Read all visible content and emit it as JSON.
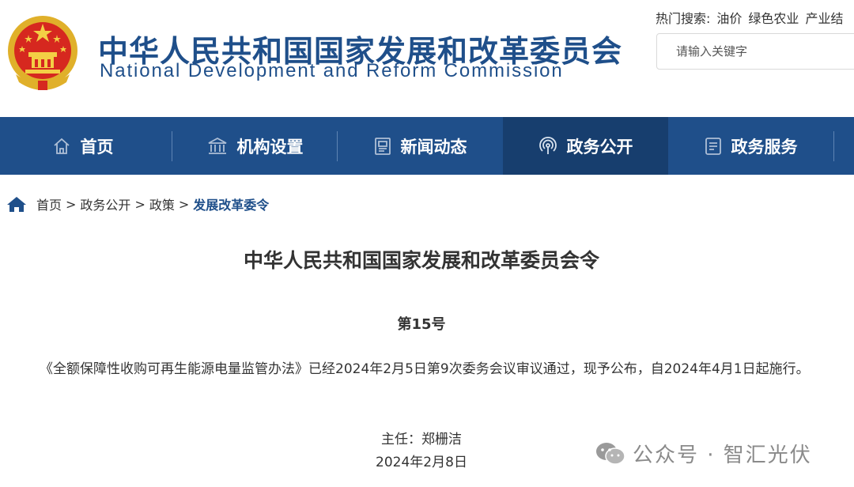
{
  "header": {
    "emblem_icon": "national-emblem",
    "title_cn": "中华人民共和国国家发展和改革委员会",
    "title_en": "National Development and Reform Commission",
    "hot_search_label": "热门搜索:",
    "hot_keywords": [
      "油价",
      "绿色农业",
      "产业结"
    ],
    "search_placeholder": "请输入关键字",
    "brand_color": "#1f4f8a"
  },
  "nav": {
    "items": [
      {
        "label": "首页",
        "icon": "home-icon"
      },
      {
        "label": "机构设置",
        "icon": "institution-icon"
      },
      {
        "label": "新闻动态",
        "icon": "news-icon"
      },
      {
        "label": "政务公开",
        "icon": "broadcast-icon",
        "active": true
      },
      {
        "label": "政务服务",
        "icon": "service-icon"
      }
    ]
  },
  "breadcrumb": {
    "items": [
      "首页",
      "政务公开",
      "政策"
    ],
    "current": "发展改革委令",
    "separator": ">"
  },
  "document": {
    "title": "中华人民共和国国家发展和改革委员会令",
    "number": "第15号",
    "body": "《全额保障性收购可再生能源电量监管办法》已经2024年2月5日第9次委务会议审议通过，现予公布，自2024年4月1日起施行。",
    "signer": "主任：郑栅洁",
    "date": "2024年2月8日"
  },
  "watermark": {
    "text": "公众号 · 智汇光伏",
    "icon": "wechat-icon"
  }
}
